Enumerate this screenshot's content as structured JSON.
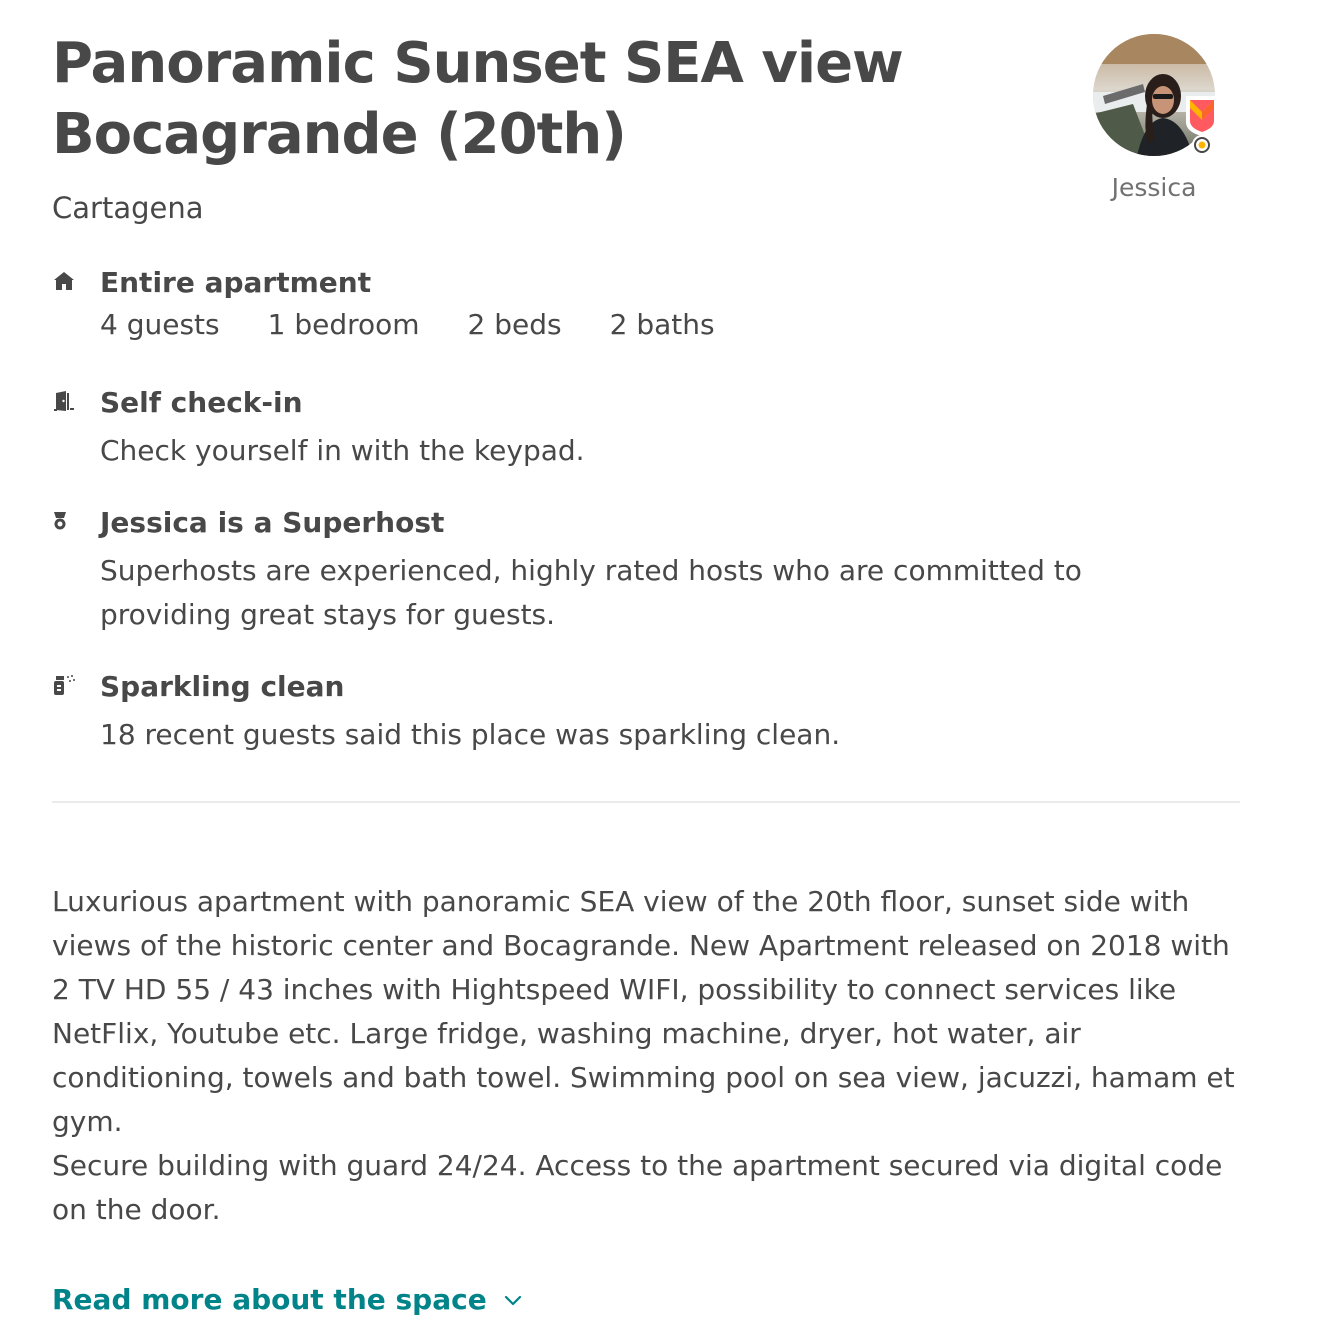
{
  "listing": {
    "title": "Panoramic Sunset SEA view Bocagrande (20th)",
    "city": "Cartagena"
  },
  "host": {
    "name": "Jessica",
    "avatar_icon": "host-avatar-photo",
    "badge_icon": "superhost-badge-icon"
  },
  "highlights": {
    "home": {
      "icon": "home-icon",
      "title": "Entire apartment",
      "stats": {
        "guests": "4 guests",
        "bedrooms": "1 bedroom",
        "beds": "2 beds",
        "baths": "2 baths"
      }
    },
    "checkin": {
      "icon": "door-icon",
      "title": "Self check-in",
      "desc": "Check yourself in with the keypad."
    },
    "superhost": {
      "icon": "superhost-medal-icon",
      "title": "Jessica is a Superhost",
      "desc": "Superhosts are experienced, highly rated hosts who are committed to providing great stays for guests."
    },
    "clean": {
      "icon": "sparkle-spray-icon",
      "title": "Sparkling clean",
      "desc": "18 recent guests said this place was sparkling clean."
    }
  },
  "description": {
    "paragraph1": "Luxurious apartment with panoramic SEA view of the 20th floor, sunset side with views of the historic center and Bocagrande. New Apartment released on 2018 with 2 TV HD 55 / 43 inches with Hightspeed WIFI, possibility to connect services like NetFlix, Youtube etc. Large fridge, washing machine, dryer, hot water, air conditioning, towels and bath towel. Swimming pool on sea view, jacuzzi, hamam et gym.",
    "paragraph2": "Secure building with guard 24/24. Access to the apartment secured via digital code on the door."
  },
  "read_more": {
    "label": "Read more about the space",
    "icon": "chevron-down-icon"
  },
  "colors": {
    "text": "#484848",
    "muted": "#717171",
    "link": "#008489",
    "divider": "#ebebeb",
    "badge": "#ff5a5f"
  }
}
